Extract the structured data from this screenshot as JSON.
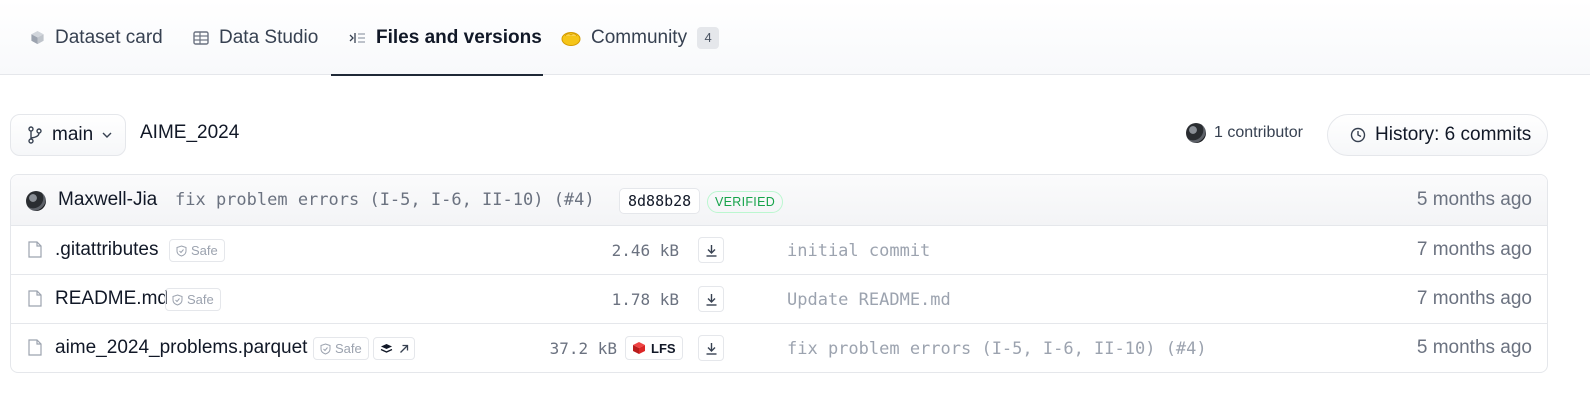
{
  "tabs": [
    {
      "label": "Dataset card",
      "icon": "cube-icon"
    },
    {
      "label": "Data Studio",
      "icon": "table-icon"
    },
    {
      "label": "Files and versions",
      "icon": "files-icon",
      "active": true
    },
    {
      "label": "Community",
      "icon": "community-icon",
      "count": "4"
    }
  ],
  "branch": {
    "label": "main",
    "icon": "branch-icon"
  },
  "path": "AIME_2024",
  "contributors": {
    "label": "1 contributor"
  },
  "history": {
    "label": "History: 6 commits",
    "icon": "clock-icon"
  },
  "last_commit": {
    "author": "Maxwell-Jia",
    "message": "fix problem errors (I-5, I-6, II-10) (#4)",
    "hash": "8d88b28",
    "verified": "VERIFIED",
    "time": "5 months ago"
  },
  "files": [
    {
      "name": ".gitattributes",
      "safe": "Safe",
      "size": "2.46 kB",
      "commit": "initial commit",
      "time": "7 months ago"
    },
    {
      "name": "README.md",
      "safe": "Safe",
      "size": "1.78 kB",
      "commit": "Update README.md",
      "time": "7 months ago"
    },
    {
      "name": "aime_2024_problems.parquet",
      "safe": "Safe",
      "size": "37.2 kB",
      "lfs": "LFS",
      "commit": "fix problem errors (I-5, I-6, II-10) (#4)",
      "time": "5 months ago"
    }
  ],
  "colors": {
    "verified": "#16a34a",
    "lfs_icon": "#dc2626",
    "community_icon": "#f5c518"
  }
}
